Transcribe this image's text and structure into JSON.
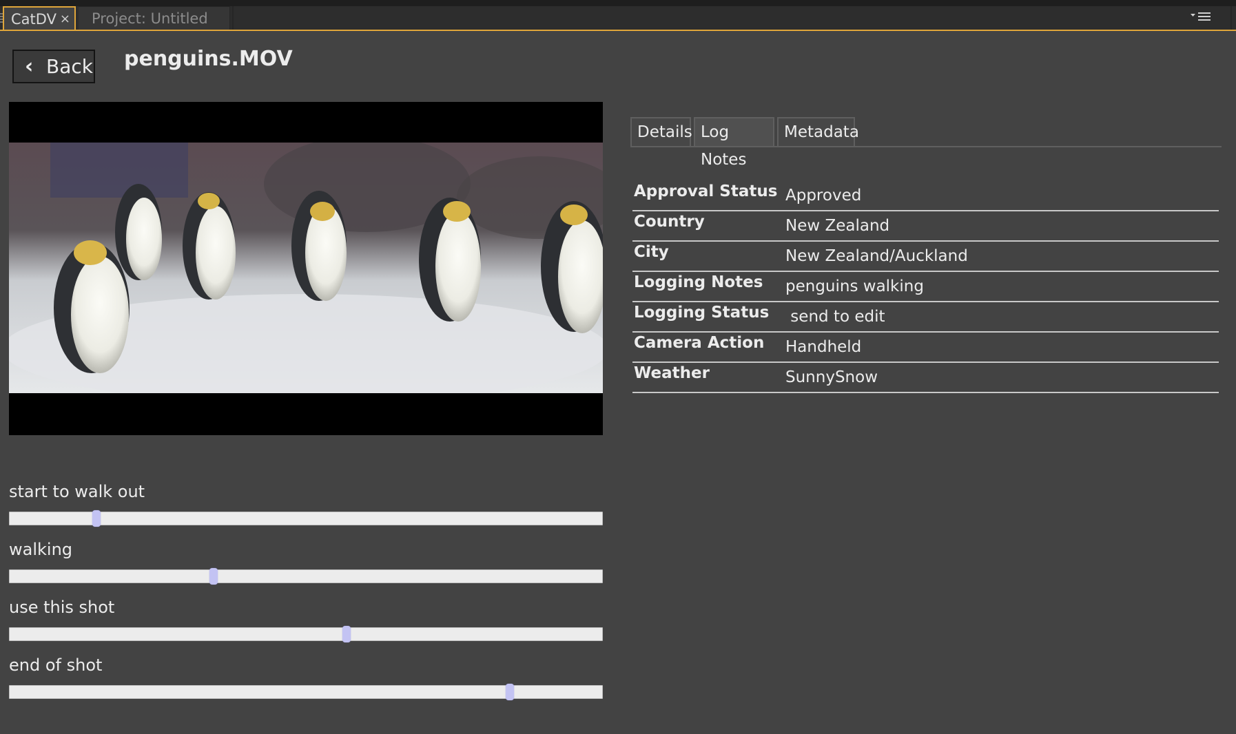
{
  "tabs": [
    {
      "label": "CatDV",
      "close": "×"
    },
    {
      "label": "Project: Untitled"
    }
  ],
  "panel_menu_icon": "panel-menu-icon",
  "back_button": {
    "label": "Back",
    "icon": "chevron-left-icon"
  },
  "clip_title": "penguins.MOV",
  "preview": {
    "subject": "penguins walking on snow"
  },
  "segments": [
    {
      "label": "start to walk out",
      "position_fraction": 0.147
    },
    {
      "label": "walking",
      "position_fraction": 0.344
    },
    {
      "label": "use this shot",
      "position_fraction": 0.569
    },
    {
      "label": "end of shot",
      "position_fraction": 0.844
    }
  ],
  "detail_tabs": [
    "Details",
    "Log Notes",
    "Metadata"
  ],
  "active_detail_tab": "Log Notes",
  "fields": [
    {
      "label": "Approval Status",
      "value": "Approved"
    },
    {
      "label": "Country",
      "value": "New Zealand"
    },
    {
      "label": "City",
      "value": "New Zealand/Auckland"
    },
    {
      "label": "Logging Notes",
      "value": "penguins walking"
    },
    {
      "label": "Logging Status",
      "value": " send to edit"
    },
    {
      "label": "Camera Action",
      "value": "Handheld"
    },
    {
      "label": "Weather",
      "value": "SunnySnow"
    }
  ],
  "colors": {
    "background": "#434343",
    "tab_accent": "#e0a63a",
    "handle": "#c3c3f3",
    "track": "#ececec"
  }
}
